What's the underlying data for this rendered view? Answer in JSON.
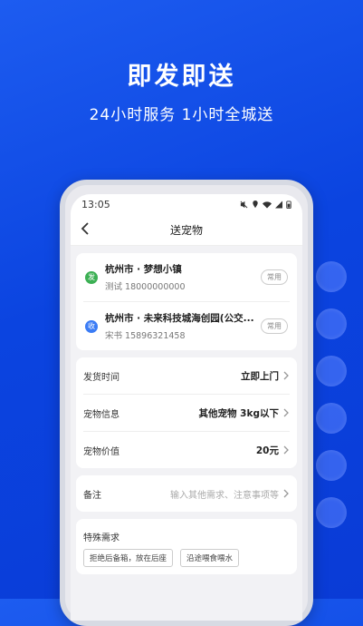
{
  "hero": {
    "title": "即发即送",
    "subtitle": "24小时服务 1小时全城送"
  },
  "status_bar": {
    "time": "13:05"
  },
  "nav": {
    "title": "送宠物"
  },
  "pickup": {
    "tag": "发",
    "address": "杭州市 · 梦想小镇",
    "contact": "测试 18000000000",
    "common_label": "常用",
    "color": "#3cb054"
  },
  "delivery": {
    "tag": "收",
    "address": "杭州市 · 未来科技城海创园(公交...",
    "contact": "宋书 15896321458",
    "common_label": "常用",
    "color": "#3b7cf5"
  },
  "details": [
    {
      "label": "发货时间",
      "value": "立即上门"
    },
    {
      "label": "宠物信息",
      "value": "其他宠物 3kg以下"
    },
    {
      "label": "宠物价值",
      "value": "20元"
    }
  ],
  "remark": {
    "label": "备注",
    "placeholder": "输入其他需求、注意事项等"
  },
  "special": {
    "title": "特殊需求",
    "options": [
      "拒绝后备箱，放在后座",
      "沿途喂食喂水"
    ]
  }
}
